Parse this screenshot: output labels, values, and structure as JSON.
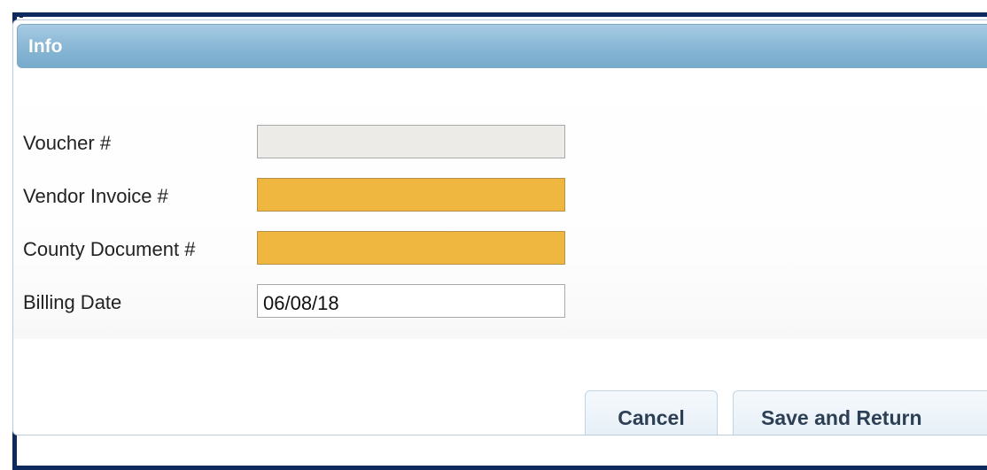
{
  "panel": {
    "title": "Info"
  },
  "form": {
    "fields": [
      {
        "label": "Voucher #",
        "value": "",
        "state": "readonly"
      },
      {
        "label": "Vendor Invoice #",
        "value": "",
        "state": "required"
      },
      {
        "label": "County Document #",
        "value": "",
        "state": "required"
      },
      {
        "label": "Billing Date",
        "value": "06/08/18",
        "state": "plain"
      }
    ]
  },
  "buttons": {
    "cancel": "Cancel",
    "save_and_return": "Save and Return"
  },
  "colors": {
    "frame_border": "#0e2a5c",
    "header_gradient_top": "#a7cbe2",
    "header_gradient_bottom": "#77aacc",
    "required_field": "#f0b740",
    "readonly_field": "#ecebe8"
  }
}
